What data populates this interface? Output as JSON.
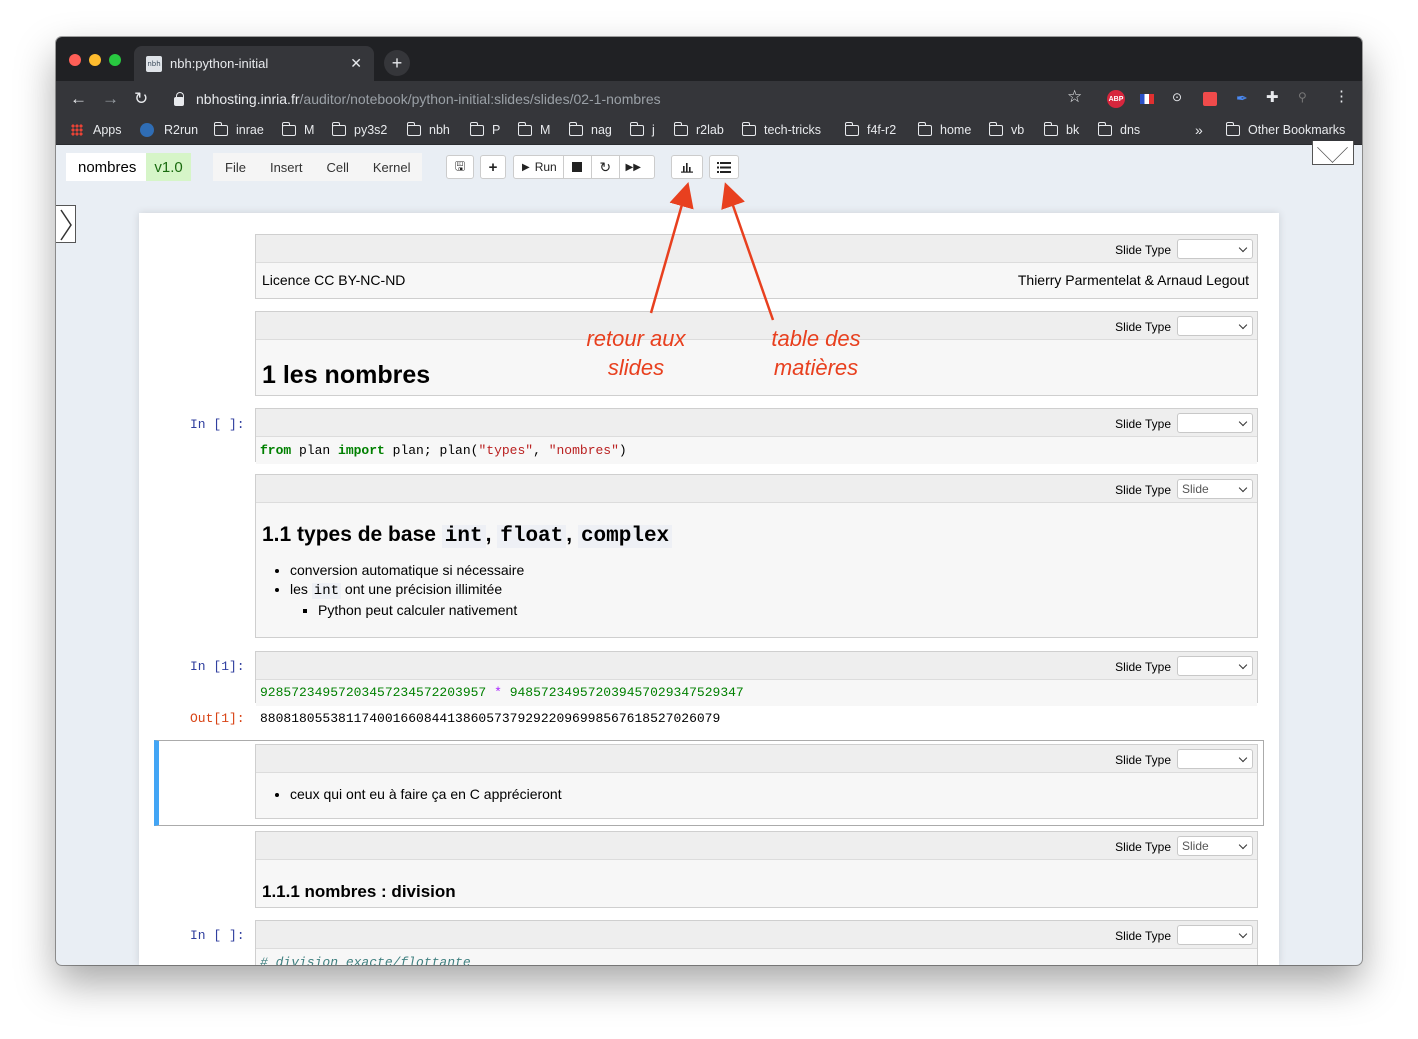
{
  "browser": {
    "tab_title": "nbh:python-initial",
    "favicon_text": "nbh",
    "url_host": "nbhosting.inria.fr",
    "url_path": "/auditor/notebook/python-initial:slides/slides/02-1-nombres",
    "bookmarks": [
      "Apps",
      "R2run",
      "inrae",
      "M",
      "py3s2",
      "nbh",
      "P",
      "M",
      "nag",
      "j",
      "r2lab",
      "tech-tricks",
      "f4f-r2",
      "home",
      "vb",
      "bk",
      "dns"
    ],
    "overflow": "»",
    "other_bookmarks": "Other Bookmarks",
    "ext_abp": "ABP"
  },
  "jupyter": {
    "notebook_name": "nombres",
    "version": "v1.0",
    "menu": [
      "File",
      "Insert",
      "Cell",
      "Kernel"
    ],
    "run_label": "Run"
  },
  "annotations": {
    "left": "retour aux slides",
    "right": "table des matières"
  },
  "cells": {
    "slide_type_label": "Slide Type",
    "slide_value": "Slide",
    "license": "Licence CC BY-NC-ND",
    "authors": "Thierry Parmentelat & Arnaud Legout",
    "h1": "1  les nombres",
    "prompt_empty": "In [ ]:",
    "prompt_1": "In [1]:",
    "out_1": "Out[1]:",
    "code1": {
      "kw1": "from",
      "t1": " plan ",
      "kw2": "import",
      "t2": " plan; plan(",
      "s1": "\"types\"",
      "t3": ", ",
      "s2": "\"nombres\"",
      "t4": ")"
    },
    "h2_prefix": "1.1  types de base ",
    "h2_int": "int",
    "h2_float": "float",
    "h2_complex": "complex",
    "bullets_1": [
      "conversion automatique si nécessaire",
      "ont une précision illimitée",
      "Python peut calculer nativement"
    ],
    "bullet_les": "les",
    "bullet_int": "int",
    "num_a": "92857234957203457234572203957",
    "mul": "*",
    "num_b": "948572349572039457029347529347",
    "result": "88081805538117400166084413860573792922096998567618527026079",
    "bullet_c": "ceux qui ont eu à faire ça en C apprécieront",
    "h3": "1.1.1  nombres : division",
    "comment": "# division exacte/flottante"
  }
}
